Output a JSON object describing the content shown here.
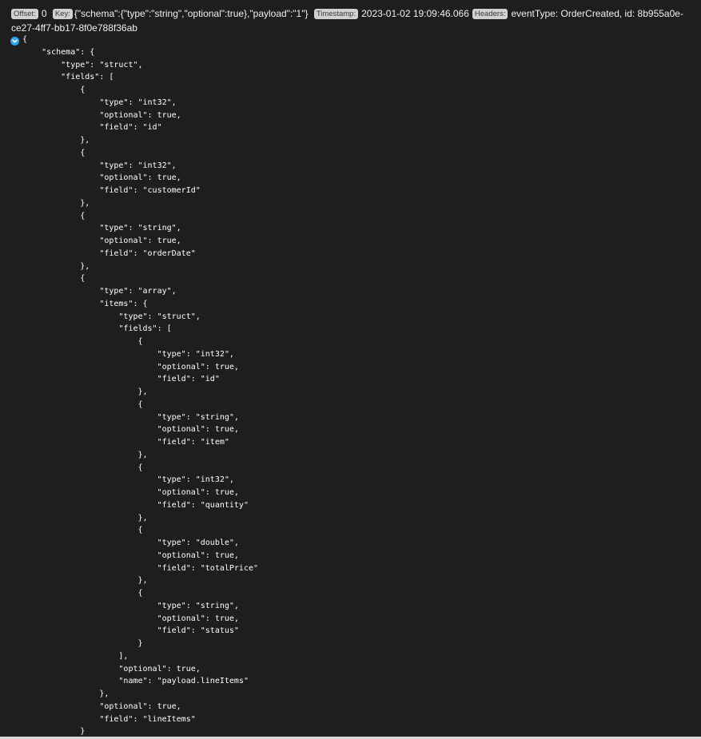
{
  "record": {
    "offset_label": "Offset:",
    "offset_value": "0",
    "key_label": "Key:",
    "key_value": "{\"schema\":{\"type\":\"string\",\"optional\":true},\"payload\":\"1\"}",
    "timestamp_label": "Timestamp:",
    "timestamp_value": "2023-01-02 19:09:46.066",
    "headers_label": "Headers:",
    "headers_value": "eventType: OrderCreated, id: 8b955a0e-ce27-4ff7-bb17-8f0e788f36ab"
  },
  "viewer": {
    "toggle_icon": "chevron-down-icon",
    "lines": [
      "{",
      "    \"schema\": {",
      "        \"type\": \"struct\",",
      "        \"fields\": [",
      "            {",
      "                \"type\": \"int32\",",
      "                \"optional\": true,",
      "                \"field\": \"id\"",
      "            },",
      "            {",
      "                \"type\": \"int32\",",
      "                \"optional\": true,",
      "                \"field\": \"customerId\"",
      "            },",
      "            {",
      "                \"type\": \"string\",",
      "                \"optional\": true,",
      "                \"field\": \"orderDate\"",
      "            },",
      "            {",
      "                \"type\": \"array\",",
      "                \"items\": {",
      "                    \"type\": \"struct\",",
      "                    \"fields\": [",
      "                        {",
      "                            \"type\": \"int32\",",
      "                            \"optional\": true,",
      "                            \"field\": \"id\"",
      "                        },",
      "                        {",
      "                            \"type\": \"string\",",
      "                            \"optional\": true,",
      "                            \"field\": \"item\"",
      "                        },",
      "                        {",
      "                            \"type\": \"int32\",",
      "                            \"optional\": true,",
      "                            \"field\": \"quantity\"",
      "                        },",
      "                        {",
      "                            \"type\": \"double\",",
      "                            \"optional\": true,",
      "                            \"field\": \"totalPrice\"",
      "                        },",
      "                        {",
      "                            \"type\": \"string\",",
      "                            \"optional\": true,",
      "                            \"field\": \"status\"",
      "                        }",
      "                    ],",
      "                    \"optional\": true,",
      "                    \"name\": \"payload.lineItems\"",
      "                },",
      "                \"optional\": true,",
      "                \"field\": \"lineItems\"",
      "            }"
    ]
  },
  "colors": {
    "background": "#1e1e1e",
    "badge_bg": "#d1d1d1",
    "badge_text": "#3a3a3a",
    "toggle": "#2aa4f4",
    "text": "#ffffff"
  }
}
